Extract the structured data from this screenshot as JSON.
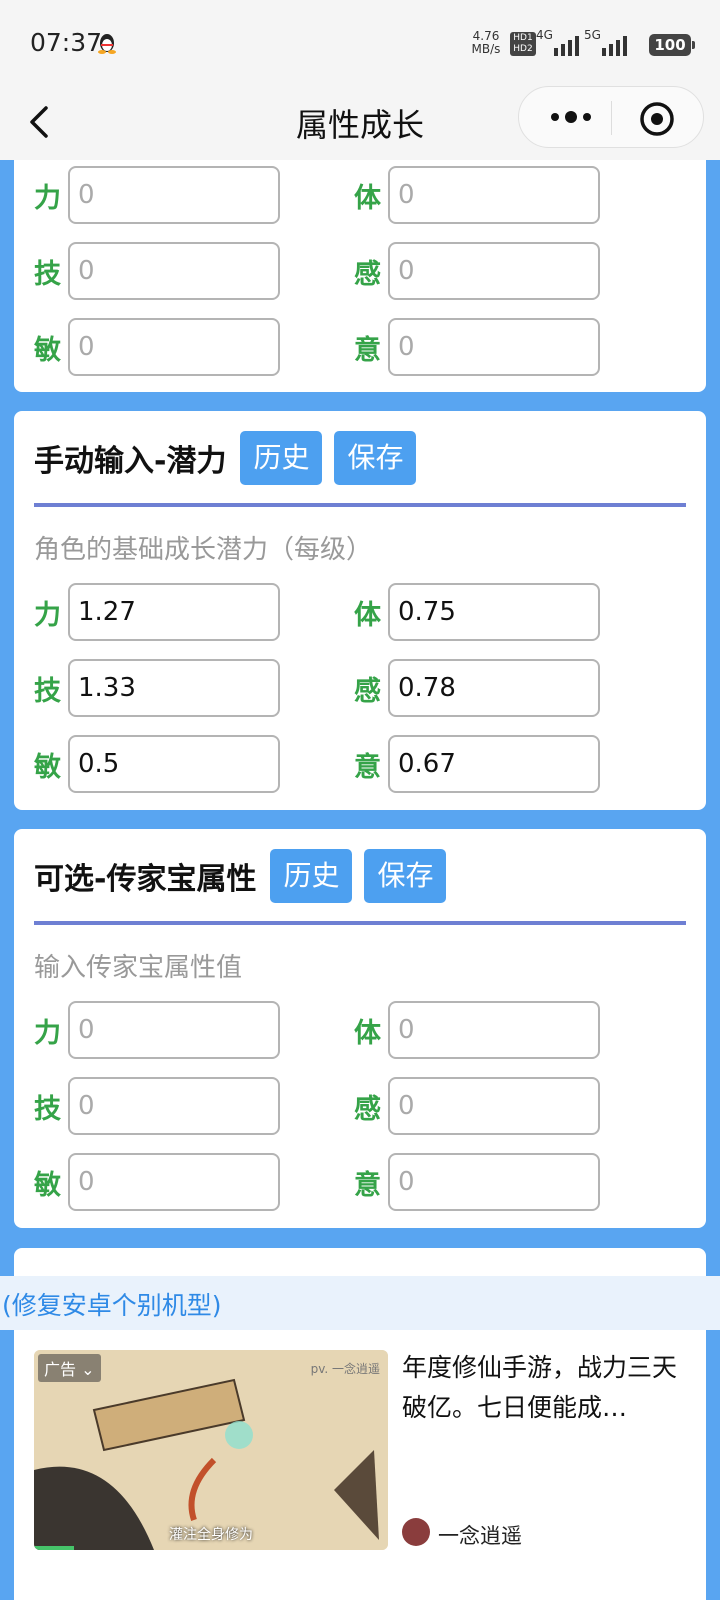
{
  "status_bar": {
    "time": "07:37",
    "net_speed_value": "4.76",
    "net_speed_unit": "MB/s",
    "hd1": "HD1",
    "hd2": "HD2",
    "signal_1": "4G",
    "signal_2": "5G",
    "battery": "100"
  },
  "nav": {
    "title": "属性成长"
  },
  "card_top": {
    "fields": [
      {
        "label": "力",
        "value": "0"
      },
      {
        "label": "体",
        "value": "0"
      },
      {
        "label": "技",
        "value": "0"
      },
      {
        "label": "感",
        "value": "0"
      },
      {
        "label": "敏",
        "value": "0"
      },
      {
        "label": "意",
        "value": "0"
      }
    ]
  },
  "card_potential": {
    "title": "手动输入-潜力",
    "history_label": "历史",
    "save_label": "保存",
    "subtitle": "角色的基础成长潜力（每级）",
    "fields": [
      {
        "label": "力",
        "value": "1.27"
      },
      {
        "label": "体",
        "value": "0.75"
      },
      {
        "label": "技",
        "value": "1.33"
      },
      {
        "label": "感",
        "value": "0.78"
      },
      {
        "label": "敏",
        "value": "0.5"
      },
      {
        "label": "意",
        "value": "0.67"
      }
    ]
  },
  "card_heirloom": {
    "title": "可选-传家宝属性",
    "history_label": "历史",
    "save_label": "保存",
    "subtitle": "输入传家宝属性值",
    "fields": [
      {
        "label": "力",
        "value": "0"
      },
      {
        "label": "体",
        "value": "0"
      },
      {
        "label": "技",
        "value": "0"
      },
      {
        "label": "感",
        "value": "0"
      },
      {
        "label": "敏",
        "value": "0"
      },
      {
        "label": "意",
        "value": "0"
      }
    ]
  },
  "banner": {
    "text": "(修复安卓个别机型)"
  },
  "ad": {
    "tag": "广告",
    "watermark": "pv. 一念逍遥",
    "caption": "灌注全身修为",
    "headline": "年度修仙手游，战力三天破亿。七日便能成…",
    "author": "一念逍遥"
  },
  "colors": {
    "page_bg": "#59a5f1",
    "accent_button": "#4da0f0",
    "label_green": "#35a348",
    "divider": "#6e7fd3",
    "banner_text": "#2f8ae6"
  }
}
